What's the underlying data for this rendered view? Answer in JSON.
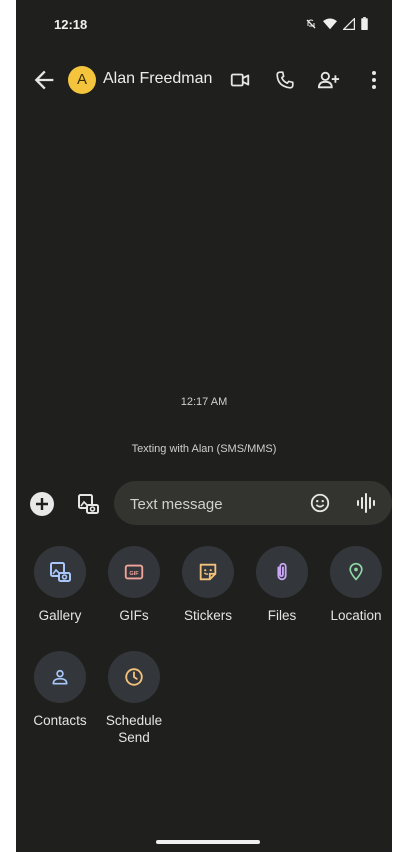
{
  "status_bar": {
    "time": "12:18",
    "icons": [
      "silent-icon",
      "wifi-icon",
      "signal-icon",
      "battery-icon"
    ]
  },
  "app_bar": {
    "avatar_letter": "A",
    "avatar_color": "#f4c43d",
    "contact_name": "Alan Freedman",
    "actions": [
      "video-call-icon",
      "phone-icon",
      "add-person-icon",
      "more-vert-icon"
    ]
  },
  "conversation": {
    "timestamp": "12:17 AM",
    "info": "Texting with Alan (SMS/MMS)"
  },
  "compose": {
    "placeholder": "Text message",
    "value": ""
  },
  "attachments": [
    {
      "label": "Gallery",
      "icon": "gallery-icon",
      "color": "#a8c7fa"
    },
    {
      "label": "GIFs",
      "icon": "gif-icon",
      "color": "#f2a49a"
    },
    {
      "label": "Stickers",
      "icon": "sticker-icon",
      "color": "#f3c27b"
    },
    {
      "label": "Files",
      "icon": "attach-file-icon",
      "color": "#c8a6f5"
    },
    {
      "label": "Location",
      "icon": "location-icon",
      "color": "#8fd6a8"
    },
    {
      "label": "Contacts",
      "icon": "contact-icon",
      "color": "#a8c7fa"
    },
    {
      "label": "Schedule\nSend",
      "icon": "clock-icon",
      "color": "#f3c27b"
    }
  ]
}
